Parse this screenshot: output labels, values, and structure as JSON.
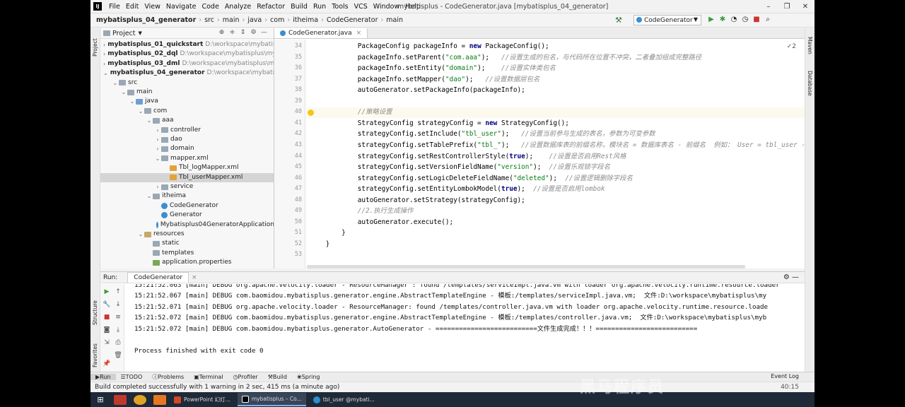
{
  "menu": {
    "items": [
      "File",
      "Edit",
      "View",
      "Navigate",
      "Code",
      "Analyze",
      "Refactor",
      "Build",
      "Run",
      "Tools",
      "VCS",
      "Window",
      "Help"
    ],
    "title": "mybatisplus - CodeGenerator.java [mybatisplus_04_generator]"
  },
  "breadcrumb": [
    "mybatisplus_04_generator",
    "src",
    "main",
    "java",
    "com",
    "itheima",
    "CodeGenerator",
    "main"
  ],
  "run_config": "CodeGenerator",
  "side_labels": {
    "project": "Project",
    "structure": "Structure",
    "favorites": "Favorites",
    "maven": "Maven",
    "database": "Database"
  },
  "project_panel": {
    "title": "Project",
    "tree": [
      {
        "label": "mybatisplus_01_quickstart",
        "path": "D:\\workspace\\mybatisplu",
        "bold": true,
        "icon": "module-icon",
        "twisty": "›"
      },
      {
        "label": "mybatisplus_02_dql",
        "path": "D:\\workspace\\mybatisplus\\myb",
        "bold": true,
        "icon": "module-icon",
        "twisty": "›"
      },
      {
        "label": "mybatisplus_03_dml",
        "path": "D:\\workspace\\mybatisplus\\my",
        "bold": true,
        "icon": "module-icon",
        "twisty": "›"
      },
      {
        "label": "mybatisplus_04_generator",
        "path": "D:\\workspace\\mybatispl",
        "bold": true,
        "icon": "module-icon",
        "twisty": "⌄"
      },
      {
        "label": "src",
        "icon": "folder-icon",
        "twisty": "⌄"
      },
      {
        "label": "main",
        "icon": "folder-icon",
        "twisty": "⌄"
      },
      {
        "label": "java",
        "icon": "source-folder-icon",
        "twisty": "⌄"
      },
      {
        "label": "com",
        "icon": "package-icon",
        "twisty": "⌄"
      },
      {
        "label": "aaa",
        "icon": "package-icon",
        "twisty": "⌄"
      },
      {
        "label": "controller",
        "icon": "package-icon",
        "twisty": "›"
      },
      {
        "label": "dao",
        "icon": "package-icon",
        "twisty": "›"
      },
      {
        "label": "domain",
        "icon": "package-icon",
        "twisty": "›"
      },
      {
        "label": "mapper.xml",
        "icon": "package-icon",
        "twisty": "⌄"
      },
      {
        "label": "Tbl_logMapper.xml",
        "icon": "xml-file-icon",
        "twisty": ""
      },
      {
        "label": "Tbl_userMapper.xml",
        "icon": "xml-file-icon",
        "twisty": "",
        "selected": true
      },
      {
        "label": "service",
        "icon": "package-icon",
        "twisty": "›"
      },
      {
        "label": "itheima",
        "icon": "package-icon",
        "twisty": "⌄"
      },
      {
        "label": "CodeGenerator",
        "icon": "class-icon",
        "twisty": ""
      },
      {
        "label": "Generator",
        "icon": "class-icon",
        "twisty": ""
      },
      {
        "label": "Mybatisplus04GeneratorApplication",
        "icon": "class-icon",
        "twisty": ""
      },
      {
        "label": "resources",
        "icon": "resources-folder-icon",
        "twisty": "⌄"
      },
      {
        "label": "static",
        "icon": "folder-icon",
        "twisty": ""
      },
      {
        "label": "templates",
        "icon": "folder-icon",
        "twisty": ""
      },
      {
        "label": "application.properties",
        "icon": "properties-file-icon",
        "twisty": ""
      }
    ]
  },
  "editor": {
    "tab": "CodeGenerator.java",
    "warnings": "2",
    "lines": [
      {
        "n": "34",
        "segs": [
          [
            "",
            "            PackageConfig packageInfo = "
          ],
          [
            "kw",
            "new"
          ],
          [
            "",
            " PackageConfig();"
          ]
        ]
      },
      {
        "n": "35",
        "segs": [
          [
            "",
            "            packageInfo.setParent("
          ],
          [
            "st",
            "\"com.aaa\""
          ],
          [
            "",
            "); "
          ],
          [
            "cm",
            "  //设置生成的包名，与代码所在位置不冲突，二者叠加组成完整路径"
          ]
        ]
      },
      {
        "n": "36",
        "segs": [
          [
            "",
            "            packageInfo.setEntity("
          ],
          [
            "st",
            "\"domain\""
          ],
          [
            "",
            "); "
          ],
          [
            "cm",
            "   //设置实体类包名"
          ]
        ]
      },
      {
        "n": "37",
        "segs": [
          [
            "",
            "            packageInfo.setMapper("
          ],
          [
            "st",
            "\"dao\""
          ],
          [
            "",
            "); "
          ],
          [
            "cm",
            "  //设置数据层包名"
          ]
        ]
      },
      {
        "n": "38",
        "segs": [
          [
            "",
            "            autoGenerator.setPackageInfo(packageInfo);"
          ]
        ]
      },
      {
        "n": "39",
        "segs": [
          [
            "",
            ""
          ]
        ]
      },
      {
        "n": "40",
        "segs": [
          [
            "cm",
            "            //策略设置"
          ]
        ]
      },
      {
        "n": "41",
        "segs": [
          [
            "",
            "            StrategyConfig strategyConfig = "
          ],
          [
            "kw",
            "new"
          ],
          [
            "",
            " StrategyConfig();"
          ]
        ]
      },
      {
        "n": "42",
        "segs": [
          [
            "",
            "            strategyConfig.setInclude("
          ],
          [
            "st",
            "\"tbl_user\""
          ],
          [
            "",
            "); "
          ],
          [
            "cm",
            "  //设置当前参与生成的表名，参数为可变参数"
          ]
        ]
      },
      {
        "n": "43",
        "segs": [
          [
            "",
            "            strategyConfig.setTablePrefix("
          ],
          [
            "st",
            "\"tbl_\""
          ],
          [
            "",
            "); "
          ],
          [
            "cm",
            "  //设置数据库表的前缀名称，模块名 = 数据库表名 - 前缀名  例如： User = tbl_user - tbl_"
          ]
        ]
      },
      {
        "n": "44",
        "segs": [
          [
            "",
            "            strategyConfig.setRestControllerStyle("
          ],
          [
            "kw",
            "true"
          ],
          [
            "",
            "); "
          ],
          [
            "cm",
            "   //设置是否启用Rest风格"
          ]
        ]
      },
      {
        "n": "45",
        "segs": [
          [
            "",
            "            strategyConfig.setVersionFieldName("
          ],
          [
            "st",
            "\"version\""
          ],
          [
            "",
            "); "
          ],
          [
            "cm",
            " //设置乐观锁字段名"
          ]
        ]
      },
      {
        "n": "46",
        "segs": [
          [
            "",
            "            strategyConfig.setLogicDeleteFieldName("
          ],
          [
            "st",
            "\"deleted\""
          ],
          [
            "",
            "); "
          ],
          [
            "cm",
            " //设置逻辑删除字段名"
          ]
        ]
      },
      {
        "n": "47",
        "segs": [
          [
            "",
            "            strategyConfig.setEntityLombokModel("
          ],
          [
            "kw",
            "true"
          ],
          [
            "",
            "); "
          ],
          [
            "cm",
            " //设置是否启用lombok"
          ]
        ]
      },
      {
        "n": "48",
        "segs": [
          [
            "",
            "            autoGenerator.setStrategy(strategyConfig);"
          ]
        ]
      },
      {
        "n": "49",
        "segs": [
          [
            "cm",
            "            //2.执行生成操作"
          ]
        ]
      },
      {
        "n": "50",
        "segs": [
          [
            "",
            "            autoGenerator.execute();"
          ]
        ]
      },
      {
        "n": "51",
        "segs": [
          [
            "",
            "        }"
          ]
        ]
      },
      {
        "n": "52",
        "segs": [
          [
            "",
            "    }"
          ]
        ]
      },
      {
        "n": "53",
        "segs": [
          [
            "",
            ""
          ]
        ]
      }
    ]
  },
  "run_panel": {
    "label": "Run:",
    "tab": "CodeGenerator",
    "output": [
      "15:21:52.063 [main] DEBUG org.apache.velocity.loader - ResourceManager : found /templates/serviceImpl.java.vm with loader org.apache.velocity.runtime.resource.loader",
      "15:21:52.067 [main] DEBUG com.baomidou.mybatisplus.generator.engine.AbstractTemplateEngine - 模板:/templates/serviceImpl.java.vm;  文件:D:\\workspace\\mybatisplus\\my",
      "15:21:52.071 [main] DEBUG org.apache.velocity.loader - ResourceManager: found /templates/controller.java.vm with loader org.apache.velocity.runtime.resource.loade",
      "15:21:52.072 [main] DEBUG com.baomidou.mybatisplus.generator.engine.AbstractTemplateEngine - 模板:/templates/controller.java.vm;  文件:D:\\workspace\\mybatisplus\\myb",
      "15:21:52.072 [main] DEBUG com.baomidou.mybatisplus.generator.AutoGenerator - ==========================文件生成完成！！！==========================",
      "",
      "Process finished with exit code 0"
    ]
  },
  "bottom_tabs": [
    "Run",
    "TODO",
    "Problems",
    "Terminal",
    "Profiler",
    "Build",
    "Spring"
  ],
  "event_log": "Event Log",
  "status": "Build completed successfully with 1 warning in 2 sec, 415 ms (a minute ago)",
  "status_right": "40:15",
  "taskbar": {
    "apps": [
      "PowerPoint 幻灯...",
      "mybatisplus – Co...",
      "tbl_user @mybati..."
    ],
    "tray": ""
  },
  "watermark": "黑马程序员",
  "colors": {
    "keyword": "#000080",
    "string": "#067d17",
    "comment": "#8c8c8c",
    "taskbar": "#1f2a38"
  }
}
